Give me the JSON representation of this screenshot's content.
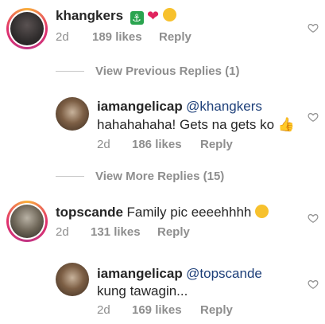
{
  "comments": [
    {
      "username": "khangkers",
      "text": "",
      "emojis": [
        "anchor-icon",
        "heart-icon",
        "hugging-face-icon"
      ],
      "time": "2d",
      "likes": "189 likes",
      "reply": "Reply"
    },
    {
      "username": "iamangelicap",
      "mention": "@khangkers",
      "text": "hahahahaha! Gets na gets ko",
      "emojis": [
        "thumbs-up-icon"
      ],
      "time": "2d",
      "likes": "186 likes",
      "reply": "Reply"
    },
    {
      "username": "topscande",
      "text": "Family pic eeeehhhh",
      "emojis": [
        "smiling-face-icon"
      ],
      "time": "2d",
      "likes": "131 likes",
      "reply": "Reply"
    },
    {
      "username": "iamangelicap",
      "mention": "@topscande",
      "text": "kung tawagin...",
      "time": "2d",
      "likes": "169 likes",
      "reply": "Reply"
    }
  ],
  "view_previous": "View Previous Replies (1)",
  "view_more": "View More Replies (15)",
  "colors": {
    "mention": "#1d3f79",
    "meta": "#8e8e8e"
  }
}
